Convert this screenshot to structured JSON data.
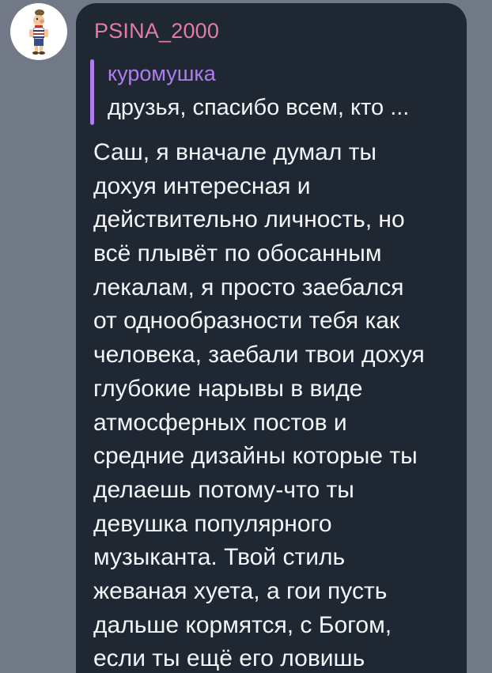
{
  "sender": {
    "name": "PSINA_2000",
    "avatar_icon": "cartoon-character-avatar",
    "name_color": "#e27ba9"
  },
  "reply": {
    "author": "куромушка",
    "text": "друзья, спасибо всем, кто ...",
    "accent_color": "#b07cf0"
  },
  "message": {
    "lines": [
      "Саш, я вначале думал ты",
      "дохуя интересная и",
      "действительно личность, но",
      "всё плывёт по обосанным",
      "лекалам, я просто заебался",
      "от однообразности тебя как",
      "человека, заебали твои дохуя",
      "глубокие нарывы в виде",
      "атмосферных постов и",
      "средние дизайны которые ты",
      "делаешь потому-что ты",
      "девушка популярного",
      "музыканта. Твой стиль",
      "жеваная хуета, а гои пусть",
      "дальше кормятся, с Богом,",
      "если ты ещё его ловишь"
    ]
  },
  "colors": {
    "bubble_bg": "#1f2733",
    "chat_bg": "#707985",
    "text": "#f4f5f7"
  }
}
